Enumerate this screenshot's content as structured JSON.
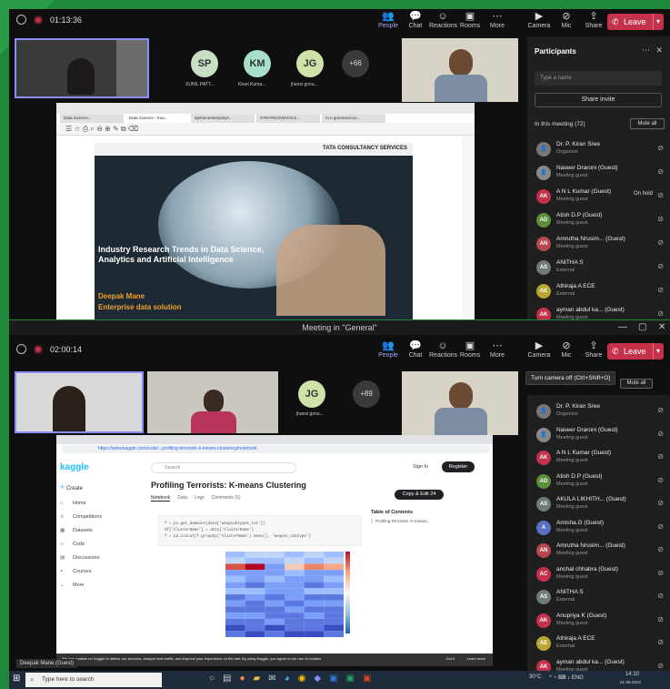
{
  "shot1": {
    "timer": "01:13:36",
    "toolbar": [
      {
        "label": "People",
        "icon": "people-icon"
      },
      {
        "label": "Chat",
        "icon": "chat-icon"
      },
      {
        "label": "Reactions",
        "icon": "reactions-icon"
      },
      {
        "label": "Rooms",
        "icon": "rooms-icon"
      },
      {
        "label": "More",
        "icon": "more-icon"
      },
      {
        "label": "Camera",
        "icon": "camera-icon"
      },
      {
        "label": "Mic",
        "icon": "mic-icon"
      },
      {
        "label": "Share",
        "icon": "share-icon"
      }
    ],
    "leave": "Leave",
    "avatars": [
      {
        "initials": "SP",
        "name": "SUNIL PATT...",
        "color": "#c8dfc4"
      },
      {
        "initials": "KM",
        "name": "Kiran Kuma...",
        "color": "#a8dfc9"
      },
      {
        "initials": "JG",
        "name": "jhansi gonu...",
        "color": "#cfe3a9"
      }
    ],
    "more_count": "+66",
    "panel": {
      "title": "Participants",
      "search_placeholder": "Type a name",
      "share_invite": "Share invite",
      "in_meeting": "In this meeting (72)",
      "mute_all": "Mute all",
      "people": [
        {
          "initials": "",
          "name": "Dr. P. Kiran Sree",
          "sub": "Organizer",
          "color": "#777",
          "extra": ""
        },
        {
          "initials": "",
          "name": "Naseer Draroni (Guest)",
          "sub": "Meeting guest",
          "color": "#888",
          "extra": ""
        },
        {
          "initials": "AK",
          "name": "A N L Kumar (Guest)",
          "sub": "Meeting guest",
          "color": "#c4314b",
          "extra": "On hold"
        },
        {
          "initials": "AD",
          "name": "Atish D.P (Guest)",
          "sub": "Meeting guest",
          "color": "#5b8f3c",
          "extra": ""
        },
        {
          "initials": "AN",
          "name": "Amrutha Nrusim... (Guest)",
          "sub": "Meeting guest",
          "color": "#b8474f",
          "extra": ""
        },
        {
          "initials": "AS",
          "name": "ANITHA S",
          "sub": "External",
          "color": "#6e7b76",
          "extra": ""
        },
        {
          "initials": "AE",
          "name": "Athiraja A ECE",
          "sub": "External",
          "color": "#b7a632",
          "extra": ""
        },
        {
          "initials": "AK",
          "name": "ayman abdul ka... (Guest)",
          "sub": "Meeting guest",
          "color": "#c4314b",
          "extra": ""
        }
      ]
    },
    "slide": {
      "brand": "TATA CONSULTANCY SERVICES",
      "title": "Industry Research Trends in Data Science, Analytics and Artificial Intelligence",
      "presenter": "Deepak Mane",
      "role": "Enterprise data solution",
      "tabs": [
        "Data Science...",
        "Data Science - Kaa...",
        "alphameetemploye...",
        "STRATEGIVESOLS...",
        "m.n greemevicon..."
      ]
    }
  },
  "shot2": {
    "window_title": "Meeting in \"General\"",
    "timer": "02:00:14",
    "toolbar": [
      {
        "label": "People",
        "icon": "people-icon"
      },
      {
        "label": "Chat",
        "icon": "chat-icon"
      },
      {
        "label": "Reactions",
        "icon": "reactions-icon"
      },
      {
        "label": "Rooms",
        "icon": "rooms-icon"
      },
      {
        "label": "More",
        "icon": "more-icon"
      },
      {
        "label": "Camera",
        "icon": "camera-icon"
      },
      {
        "label": "Mic",
        "icon": "mic-icon"
      },
      {
        "label": "Share",
        "icon": "share-icon"
      }
    ],
    "leave": "Leave",
    "tooltip": "Turn camera off (Ctrl+Shift+O)",
    "mute_all": "Mute all",
    "avatar": {
      "initials": "JG",
      "name": "jhansi gonu...",
      "color": "#cfe3a9"
    },
    "more_count": "+89",
    "self_label": "Deepak Mane (Guest)",
    "people": [
      {
        "initials": "",
        "name": "Dr. P. Kiran Sree",
        "sub": "Organizer",
        "color": "#777"
      },
      {
        "initials": "",
        "name": "Naseer Draroni (Guest)",
        "sub": "Meeting guest",
        "color": "#888"
      },
      {
        "initials": "AK",
        "name": "A N L Kumar (Guest)",
        "sub": "Meeting guest",
        "color": "#c4314b"
      },
      {
        "initials": "AD",
        "name": "Atish D.P (Guest)",
        "sub": "Meeting guest",
        "color": "#5b8f3c"
      },
      {
        "initials": "AS",
        "name": "AKULA LIKHITH... (Guest)",
        "sub": "Meeting guest",
        "color": "#6e7b76"
      },
      {
        "initials": "A",
        "name": "Amisha.G (Guest)",
        "sub": "Meeting guest",
        "color": "#5b6ec4"
      },
      {
        "initials": "AN",
        "name": "Amrutha Nrusim... (Guest)",
        "sub": "Meeting guest",
        "color": "#b8474f"
      },
      {
        "initials": "AC",
        "name": "anchal chhabra (Guest)",
        "sub": "Meeting guest",
        "color": "#c4314b"
      },
      {
        "initials": "AS",
        "name": "ANITHA S",
        "sub": "External",
        "color": "#6e7b76"
      },
      {
        "initials": "AK",
        "name": "Anupriya K (Guest)",
        "sub": "Meeting guest",
        "color": "#c4314b"
      },
      {
        "initials": "AE",
        "name": "Athiraja A ECE",
        "sub": "External",
        "color": "#b7a632"
      },
      {
        "initials": "AK",
        "name": "ayman abdul ka... (Guest)",
        "sub": "Meeting guest",
        "color": "#c4314b"
      }
    ],
    "kaggle": {
      "url": "https://www.kaggle.com/code/...profiling-terrorists-k-means-clustering/notebook",
      "logo": "kaggle",
      "search": "Search",
      "sign_in": "Sign In",
      "register": "Register",
      "create": "Create",
      "nav": [
        "Home",
        "Competitions",
        "Datasets",
        "Code",
        "Discussions",
        "Courses",
        "More"
      ],
      "title": "Profiling Terrorists: K-means Clustering",
      "subtabs": [
        "Notebook",
        "Data",
        "Logs",
        "Comments (5)"
      ],
      "copy_edit": "Copy & Edit",
      "copy_count": "24",
      "toc_title": "Table of Contents",
      "toc_item": "Profiling Terrorists: K-means...",
      "code_lines": [
        "f = px.get_dummies(data['weapsubtype1_txt'])",
        "df['ClusterName'] = data['ClusterName']",
        "f = pd.concat(f.groupby('ClusterName').mean(), 'weapon_subtype')"
      ],
      "cookie": "We use cookies on Kaggle to deliver our services, analyze web traffic, and improve your experience on the site. By using Kaggle, you agree to our use of cookies.",
      "got_it": "Got it",
      "learn_more": "Learn more"
    },
    "taskbar": {
      "search": "Type here to search",
      "temp": "30°C",
      "time": "14:10",
      "date": "21-05-2022"
    }
  }
}
